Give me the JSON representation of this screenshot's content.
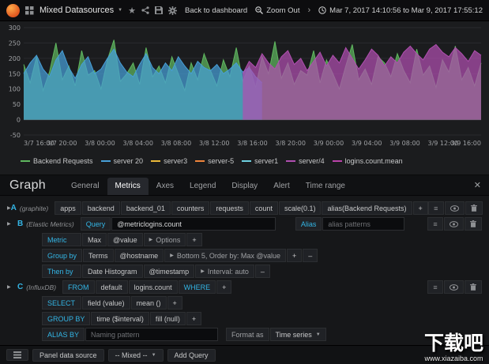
{
  "icons": {
    "star": "★",
    "menu": "≡",
    "caret_down": "▼",
    "caret_right": "▶",
    "plus": "+",
    "minus": "–",
    "close": "✕",
    "chev_right": "›"
  },
  "navbar": {
    "title": "Mixed Datasources",
    "back_label": "Back to dashboard",
    "zoom_out_label": "Zoom Out",
    "time_range": "Mar 7, 2017 14:10:56 to Mar 9, 2017 17:55:12"
  },
  "chart_data": {
    "type": "area",
    "ylim": [
      -50,
      300
    ],
    "yticks": [
      300,
      250,
      200,
      150,
      100,
      50,
      0,
      -50
    ],
    "xticks": [
      "3/7 16:00",
      "3/7 20:00",
      "3/8 00:00",
      "3/8 04:00",
      "3/8 08:00",
      "3/8 12:00",
      "3/8 16:00",
      "3/8 20:00",
      "3/9 00:00",
      "3/9 04:00",
      "3/9 08:00",
      "3/9 12:00",
      "3/9 16:00"
    ],
    "n_points": 72,
    "series": [
      {
        "name": "Backend Requests",
        "color": "#5fb75f",
        "start": 0,
        "values": [
          180,
          120,
          205,
          95,
          155,
          250,
          130,
          175,
          110,
          225,
          145,
          160,
          100,
          195,
          260,
          125,
          150,
          185,
          115,
          235,
          140,
          175,
          120,
          205,
          150,
          95,
          185,
          130,
          215,
          160,
          110,
          195,
          140,
          235,
          125,
          175,
          105,
          205,
          150,
          255,
          135,
          185,
          115,
          160,
          145,
          225,
          120,
          195,
          150,
          100,
          175,
          245,
          130,
          165,
          115,
          205,
          185,
          140,
          215,
          160,
          120,
          230,
          145,
          175,
          105,
          195,
          155,
          240,
          130,
          170,
          110,
          185
        ]
      },
      {
        "name": "server 20",
        "color": "#479fd8",
        "start": 0,
        "values": [
          150,
          185,
          210,
          165,
          140,
          195,
          225,
          170,
          135,
          180,
          205,
          150,
          165,
          200,
          230,
          185,
          155,
          140,
          180,
          215,
          170,
          150,
          185,
          160,
          205,
          175,
          150,
          190,
          170,
          160,
          180,
          150,
          165,
          185,
          155,
          170,
          140,
          120
        ]
      },
      {
        "name": "server/4",
        "color": "#b04fb0",
        "start": 34,
        "values": [
          150,
          190,
          170,
          215,
          185,
          165,
          205,
          225,
          180,
          200,
          160,
          190,
          220,
          175,
          210,
          185,
          235,
          200,
          165,
          195,
          230,
          210,
          175,
          205,
          185,
          220,
          240,
          215,
          195,
          230,
          245,
          220,
          205,
          235,
          215,
          190,
          225,
          210
        ]
      }
    ]
  },
  "legend": {
    "items": [
      {
        "label": "Backend Requests",
        "color": "#5fb75f"
      },
      {
        "label": "server 20",
        "color": "#479fd8"
      },
      {
        "label": "server3",
        "color": "#eab839"
      },
      {
        "label": "server-5",
        "color": "#ef843c"
      },
      {
        "label": "server1",
        "color": "#6ed0e0"
      },
      {
        "label": "server/4",
        "color": "#b04fb0"
      },
      {
        "label": "logins.count.mean",
        "color": "#ba43a9"
      }
    ]
  },
  "editor": {
    "title": "Graph",
    "tabs": [
      "General",
      "Metrics",
      "Axes",
      "Legend",
      "Display",
      "Alert",
      "Time range"
    ],
    "active_tab": "Metrics"
  },
  "queries": {
    "a": {
      "ref": "A",
      "ds": "(graphite)",
      "segments": [
        "apps",
        "backend",
        "backend_01",
        "counters",
        "requests",
        "count",
        "scale(0.1)",
        "alias(Backend Requests)"
      ]
    },
    "b": {
      "ref": "B",
      "ds": "(Elastic Metrics)",
      "query_label": "Query",
      "query_value": "@metriclogins.count",
      "alias_label": "Alias",
      "alias_placeholder": "alias patterns",
      "metric": {
        "label": "Metric",
        "agg": "Max",
        "field": "@value",
        "options": "Options"
      },
      "group_by": {
        "label": "Group by",
        "type": "Terms",
        "field": "@hostname",
        "options": "Bottom 5, Order by: Max @value"
      },
      "then_by": {
        "label": "Then by",
        "type": "Date Histogram",
        "field": "@timestamp",
        "options": "Interval: auto"
      }
    },
    "c": {
      "ref": "C",
      "ds": "(InfluxDB)",
      "from_label": "FROM",
      "from_policy": "default",
      "measurement": "logins.count",
      "where_label": "WHERE",
      "select_label": "SELECT",
      "select_field": "field (value)",
      "select_func": "mean ()",
      "groupby_label": "GROUP BY",
      "groupby_time": "time ($interval)",
      "groupby_fill": "fill (null)",
      "aliasby_label": "ALIAS BY",
      "aliasby_placeholder": "Naming pattern",
      "format_label": "Format as",
      "format_value": "Time series"
    }
  },
  "bottom": {
    "panel_ds_label": "Panel data source",
    "ds_value": "-- Mixed --",
    "add_query_label": "Add Query"
  },
  "watermark": {
    "title": "下载吧",
    "url": "www.xiazaiba.com"
  }
}
